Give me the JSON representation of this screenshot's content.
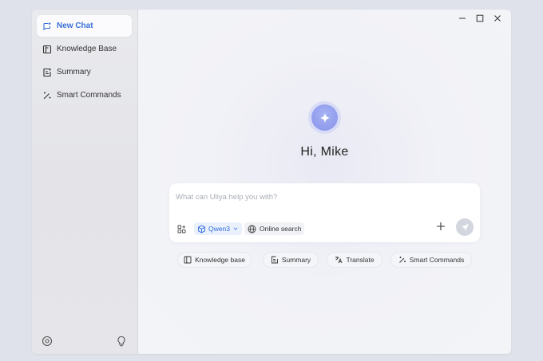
{
  "sidebar": {
    "items": [
      {
        "label": "New Chat",
        "icon": "new-chat-icon",
        "active": true
      },
      {
        "label": "Knowledge Base",
        "icon": "book-icon"
      },
      {
        "label": "Summary",
        "icon": "summary-icon"
      },
      {
        "label": "Smart Commands",
        "icon": "magic-wand-icon"
      }
    ],
    "footer_icons": [
      "settings-icon",
      "lightbulb-icon"
    ]
  },
  "window_controls": [
    "minimize-icon",
    "maximize-icon",
    "close-icon"
  ],
  "main": {
    "greeting": "Hi, Mike",
    "composer": {
      "placeholder": "What can Uliya help you with?",
      "model": "Qwen3",
      "search_label": "Online search"
    },
    "quick_actions": [
      {
        "label": "Knowledge base",
        "icon": "book-icon"
      },
      {
        "label": "Summary",
        "icon": "summary-icon"
      },
      {
        "label": "Translate",
        "icon": "translate-icon"
      },
      {
        "label": "Smart Commands",
        "icon": "magic-wand-icon"
      }
    ]
  },
  "colors": {
    "accent": "#3b6fd8",
    "background": "#dfe2ea",
    "logo": "#8f9cf0"
  }
}
